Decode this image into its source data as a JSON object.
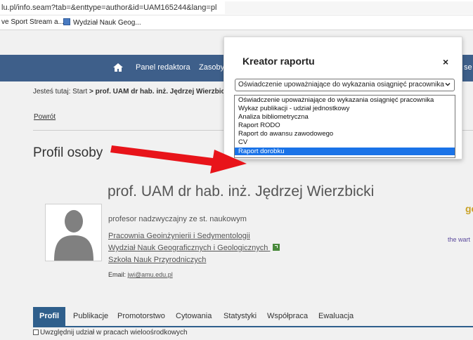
{
  "browser": {
    "url": "lu.pl/info.seam?tab=&enttype=author&id=UAM165244&lang=pl",
    "bookmarks": [
      "ve Sport Stream a...",
      "Wydział Nauk Geog..."
    ]
  },
  "navbar": {
    "items": [
      "Panel redaktora",
      "Zasoby"
    ],
    "right_fragment": "se"
  },
  "breadcrumb": {
    "prefix": "Jesteś tutaj:",
    "start": "Start",
    "separator": ">",
    "current": "prof. UAM dr hab. inż. Jędrzej Wierzbick"
  },
  "back_link": "Powrót",
  "page_title": "Profil osoby",
  "profile": {
    "name": "prof. UAM dr hab. inż. Jędrzej Wierzbicki",
    "position": "profesor nadzwyczajny ze st. naukowym",
    "units": [
      "Pracownia Geoinżynierii i Sedymentologii",
      "Wydział Nauk Geograficznych i Geologicznych",
      "Szkoła Nauk Przyrodniczych"
    ],
    "email_label": "Email:",
    "email": "jwi@amu.edu.pl",
    "right_fragment_1": "ge",
    "right_fragment_2": "the wart"
  },
  "tabs": [
    "Profil",
    "Publikacje",
    "Promotorstwo",
    "Cytowania",
    "Statystyki",
    "Współpraca",
    "Ewaluacja"
  ],
  "checkbox_label": "Uwzględnij udział w pracach wieloośrodkowych",
  "modal": {
    "title": "Kreator raportu",
    "close": "×",
    "selected_value": "Oświadczenie upoważniające do wykazania osiągnięć pracownika",
    "options": [
      "Oświadczenie upoważniające do wykazania osiągnięć pracownika",
      "Wykaz publikacji - udział jednostkowy",
      "Analiza bibliometryczna",
      "Raport RODO",
      "Raport do awansu zawodowego",
      "CV",
      "Raport dorobku"
    ],
    "highlighted_option": "Raport dorobku"
  },
  "colors": {
    "navbar": "#3e5f8a",
    "tab_active": "#2f5f8c",
    "dropdown_highlight": "#1a73e8",
    "annotation_arrow": "#e8141a"
  }
}
